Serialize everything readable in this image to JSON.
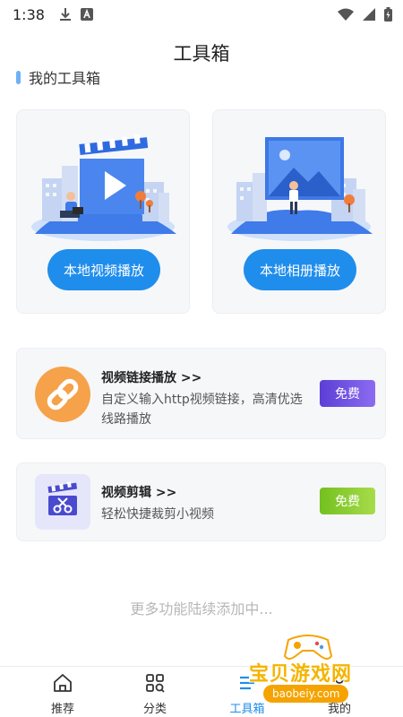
{
  "status_bar": {
    "time": "1:38"
  },
  "page_title": "工具箱",
  "section_title": "我的工具箱",
  "tool_cards": [
    {
      "button_label": "本地视频播放",
      "icon": "video-illustration"
    },
    {
      "button_label": "本地相册播放",
      "icon": "album-illustration"
    }
  ],
  "features": [
    {
      "title": "视频链接播放 >>",
      "description": "自定义输入http视频链接，高清优选线路播放",
      "badge": "免费",
      "icon": "link-icon",
      "badge_color": "#6a4ee0"
    },
    {
      "title": "视频剪辑 >>",
      "description": "轻松快捷裁剪小视频",
      "badge": "免费",
      "icon": "clapperboard-scissors-icon",
      "badge_color": "#8fcf34"
    }
  ],
  "more_text": "更多功能陆续添加中...",
  "bottom_nav": [
    {
      "label": "推荐",
      "icon": "home-icon"
    },
    {
      "label": "分类",
      "icon": "category-search-icon"
    },
    {
      "label": "工具箱",
      "icon": "toolbox-icon",
      "active": true
    },
    {
      "label": "我的",
      "icon": "profile-icon"
    }
  ],
  "watermark": {
    "title": "宝贝游戏网",
    "url": "baobeiy.com"
  },
  "colors": {
    "accent": "#1f8dec",
    "card_bg": "#f6f7f9",
    "link_icon_bg": "#f5a24a"
  }
}
